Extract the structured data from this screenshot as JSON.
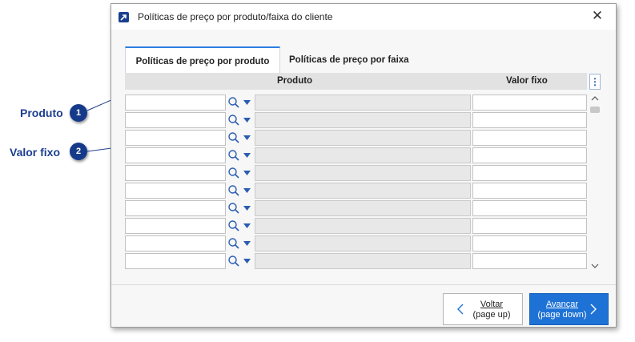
{
  "window": {
    "title": "Políticas de preço por produto/faixa do cliente",
    "close_glyph": "✕",
    "icon": "app-arrow-icon"
  },
  "tabs": [
    {
      "label": "Políticas de preço por produto",
      "active": true
    },
    {
      "label": "Políticas de preço por faixa",
      "active": false
    }
  ],
  "grid": {
    "headers": {
      "produto": "Produto",
      "valor": "Valor fixo"
    },
    "menu_glyph": "⋮",
    "rows": [
      {
        "code": "",
        "product": "",
        "value": ""
      },
      {
        "code": "",
        "product": "",
        "value": ""
      },
      {
        "code": "",
        "product": "",
        "value": ""
      },
      {
        "code": "",
        "product": "",
        "value": ""
      },
      {
        "code": "",
        "product": "",
        "value": ""
      },
      {
        "code": "",
        "product": "",
        "value": ""
      },
      {
        "code": "",
        "product": "",
        "value": ""
      },
      {
        "code": "",
        "product": "",
        "value": ""
      },
      {
        "code": "",
        "product": "",
        "value": ""
      },
      {
        "code": "",
        "product": "",
        "value": ""
      }
    ]
  },
  "buttons": {
    "back": {
      "line1": "Voltar",
      "line2": "(page up)"
    },
    "next": {
      "line1": "Avançar",
      "line2": "(page down)"
    }
  },
  "callouts": [
    {
      "label": "Produto",
      "number": "1"
    },
    {
      "label": "Valor fixo",
      "number": "2"
    }
  ],
  "colors": {
    "accent": "#1e72d6",
    "callout": "#1d3f91",
    "badge": "#163a8a",
    "icon": "#2a5db0"
  }
}
